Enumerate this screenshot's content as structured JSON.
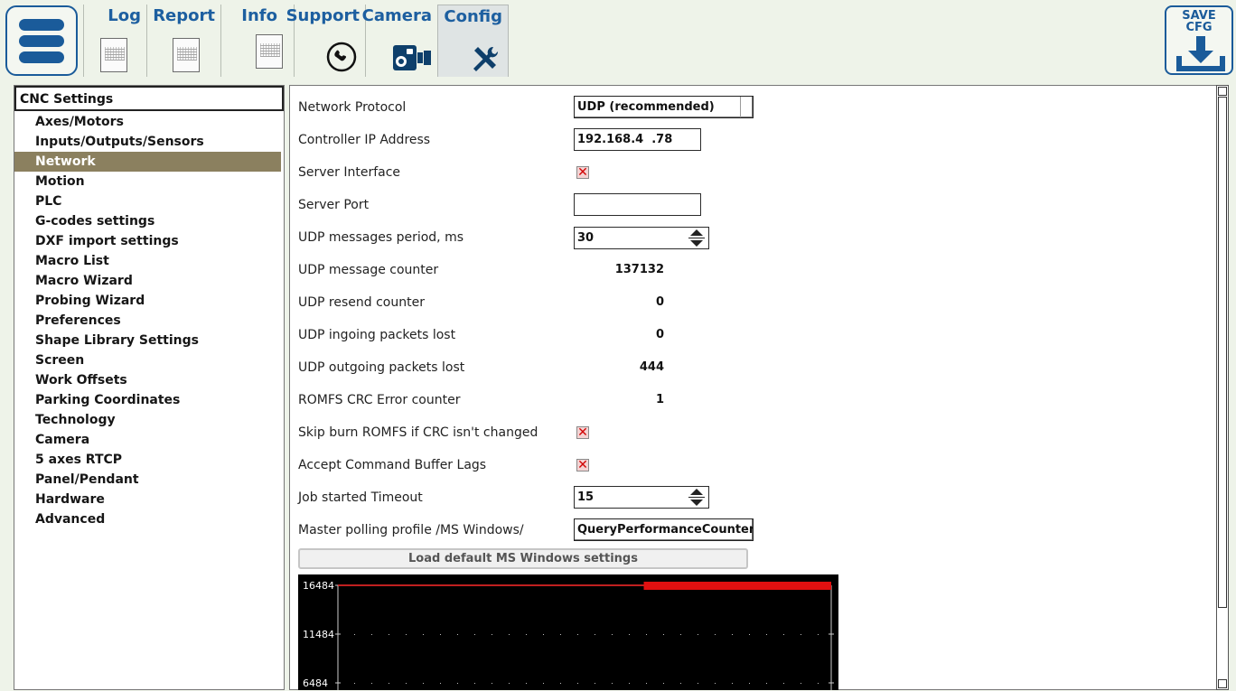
{
  "tabs": [
    {
      "label": "Log",
      "icon": "document-icon"
    },
    {
      "label": "Report",
      "icon": "document-icon"
    },
    {
      "label": "Info",
      "icon": "document-icon"
    },
    {
      "label": "Support",
      "icon": "phone-icon"
    },
    {
      "label": "Camera",
      "icon": "camera-icon"
    },
    {
      "label": "Config",
      "icon": "tools-icon",
      "active": true
    }
  ],
  "save_button": {
    "label": "SAVE\nCFG",
    "icon": "download-icon"
  },
  "sidebar": {
    "root": "CNC Settings",
    "items": [
      "Axes/Motors",
      "Inputs/Outputs/Sensors",
      "Network",
      "Motion",
      "PLC",
      "G-codes settings",
      "DXF import settings",
      "Macro List",
      "Macro Wizard",
      "Probing Wizard",
      "Preferences",
      "Shape Library Settings",
      "Screen",
      "Work Offsets",
      "Parking Coordinates",
      "Technology",
      "Camera",
      "5 axes RTCP",
      "Panel/Pendant",
      "Hardware",
      "Advanced"
    ],
    "selected": "Network"
  },
  "settings": {
    "network_protocol": {
      "label": "Network Protocol",
      "value": "UDP (recommended)"
    },
    "controller_ip": {
      "label": "Controller IP Address",
      "value": "192.168.4  .78"
    },
    "server_interface": {
      "label": "Server Interface",
      "checked": true
    },
    "server_port": {
      "label": "Server Port",
      "value": ""
    },
    "udp_period": {
      "label": "UDP messages period, ms",
      "value": "30"
    },
    "udp_counter": {
      "label": "UDP message counter",
      "value": "137132"
    },
    "udp_resend": {
      "label": "UDP resend counter",
      "value": "0"
    },
    "udp_in_lost": {
      "label": "UDP ingoing packets lost",
      "value": "0"
    },
    "udp_out_lost": {
      "label": "UDP outgoing packets lost",
      "value": "444"
    },
    "romfs_crc": {
      "label": "ROMFS CRC Error counter",
      "value": "1"
    },
    "skip_burn": {
      "label": "Skip burn ROMFS if CRC isn't changed",
      "checked": true
    },
    "accept_lags": {
      "label": "Accept Command Buffer Lags",
      "checked": true
    },
    "job_timeout": {
      "label": "Job started Timeout",
      "value": "15"
    },
    "polling_profile": {
      "label": "Master polling profile /MS Windows/",
      "value": "QueryPerformanceCounter"
    },
    "load_defaults": {
      "label": "Load default MS Windows settings"
    }
  },
  "chart_data": {
    "type": "line",
    "y_tick_labels": [
      "16484",
      "11484",
      "6484"
    ],
    "series": [
      {
        "values_description": "flat line at top value",
        "y": 16484,
        "x_range": [
          0,
          1
        ]
      },
      {
        "values_description": "thick red band at top",
        "y": 16484,
        "x_range": [
          0.62,
          1
        ]
      }
    ],
    "background": "#000000",
    "line_color": "#ff2a2a",
    "grid": true
  },
  "colors": {
    "accent": "#1a5b9a",
    "selection": "#8b805f",
    "check": "#d10000"
  }
}
